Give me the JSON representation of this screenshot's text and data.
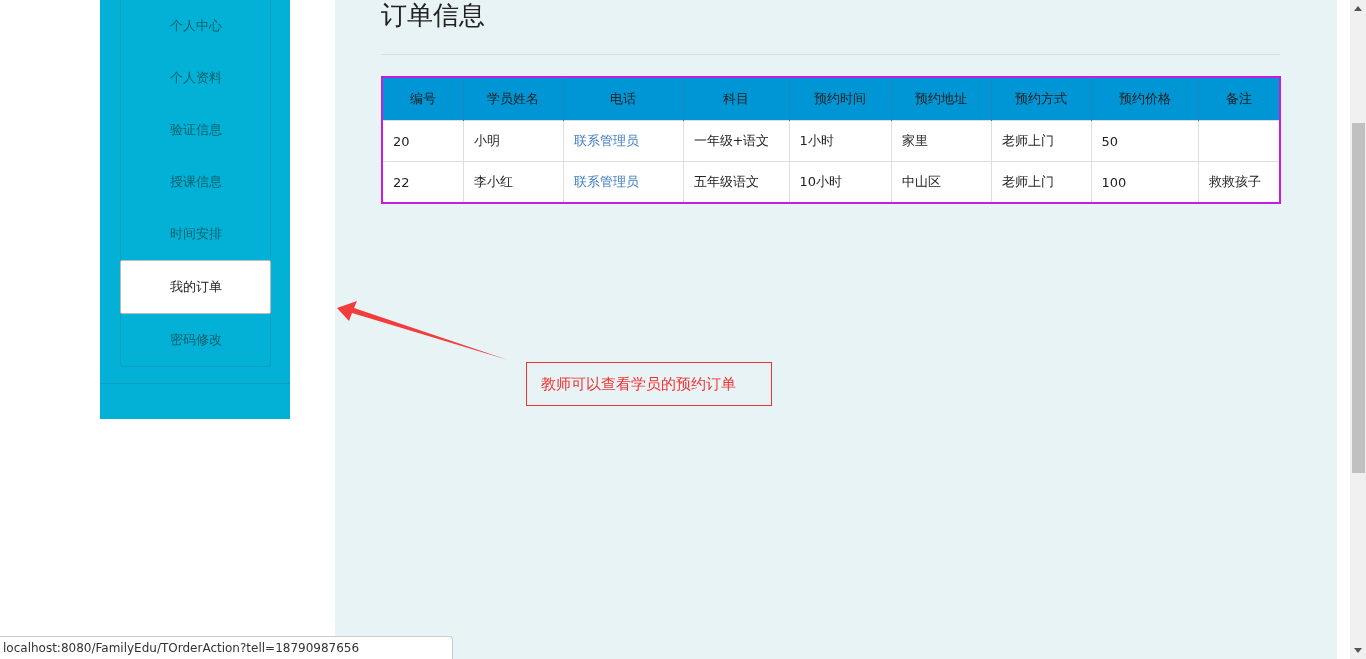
{
  "sidebar": {
    "items": [
      {
        "label": "个人中心",
        "selected": false
      },
      {
        "label": "个人资料",
        "selected": false
      },
      {
        "label": "验证信息",
        "selected": false
      },
      {
        "label": "授课信息",
        "selected": false
      },
      {
        "label": "时间安排",
        "selected": false
      },
      {
        "label": "我的订单",
        "selected": true
      },
      {
        "label": "密码修改",
        "selected": false
      }
    ]
  },
  "main": {
    "title": "订单信息",
    "table": {
      "columns": [
        "编号",
        "学员姓名",
        "电话",
        "科目",
        "预约时间",
        "预约地址",
        "预约方式",
        "预约价格",
        "备注"
      ],
      "rows": [
        {
          "cells": [
            {
              "text": "20",
              "kind": "text"
            },
            {
              "text": "小明",
              "kind": "text"
            },
            {
              "text": "联系管理员",
              "kind": "link"
            },
            {
              "text": "一年级+语文",
              "kind": "text"
            },
            {
              "text": "1小时",
              "kind": "text"
            },
            {
              "text": "家里",
              "kind": "text"
            },
            {
              "text": "老师上门",
              "kind": "text"
            },
            {
              "text": "50",
              "kind": "text"
            },
            {
              "kind": "empty"
            }
          ]
        },
        {
          "cells": [
            {
              "text": "22",
              "kind": "text"
            },
            {
              "text": "李小红",
              "kind": "text"
            },
            {
              "text": "联系管理员",
              "kind": "link"
            },
            {
              "text": "五年级语文",
              "kind": "text"
            },
            {
              "text": "10小时",
              "kind": "text"
            },
            {
              "text": "中山区",
              "kind": "text"
            },
            {
              "text": "老师上门",
              "kind": "text"
            },
            {
              "text": "100",
              "kind": "text"
            },
            {
              "text": "救救孩子",
              "kind": "text"
            }
          ]
        }
      ]
    },
    "annotation": {
      "text": "教师可以查看学员的预约订单"
    }
  },
  "status_bar": {
    "url": "localhost:8080/FamilyEdu/TOrderAction?tell=18790987656"
  }
}
